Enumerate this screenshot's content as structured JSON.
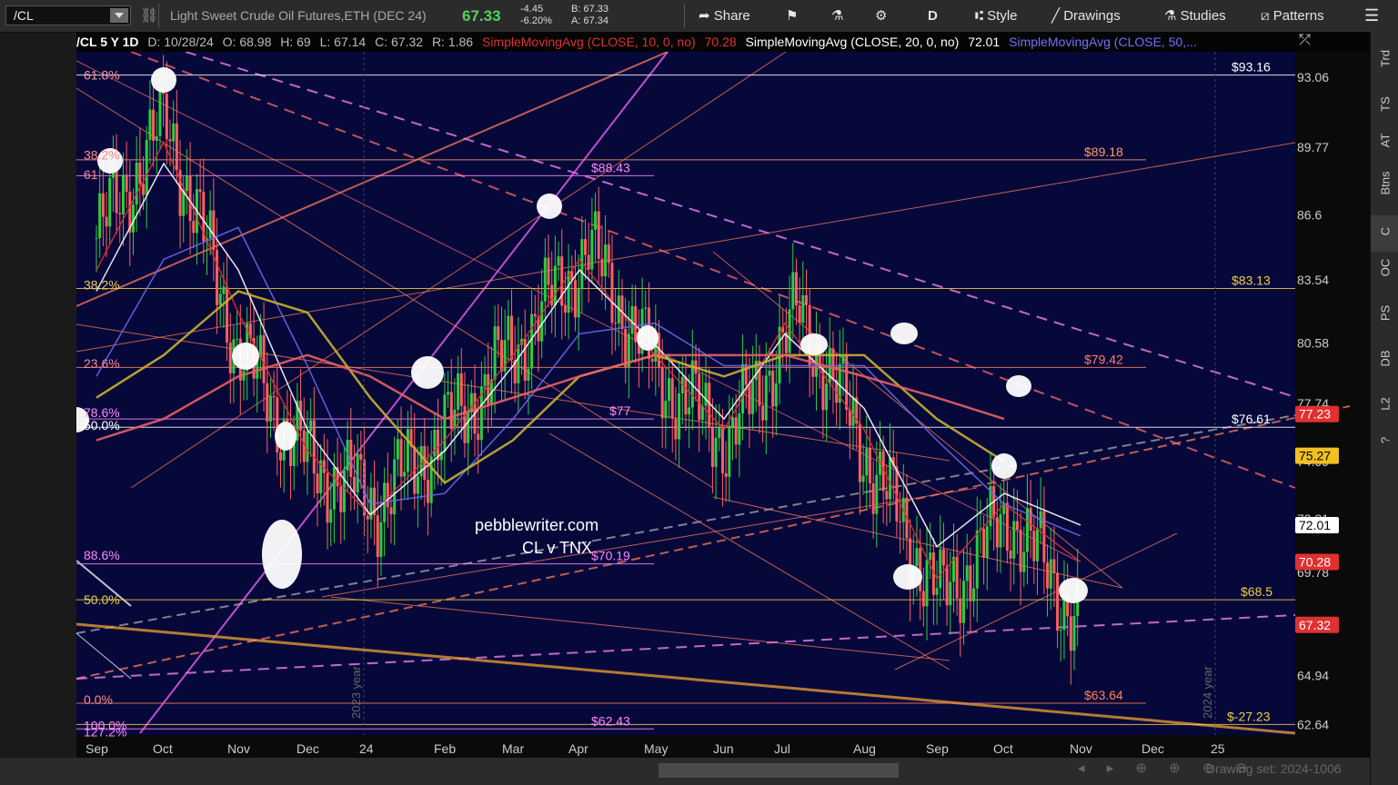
{
  "toolbar": {
    "symbol": "/CL",
    "description": "Light Sweet Crude Oil Futures,ETH (DEC 24)",
    "last": "67.33",
    "net_change": "-4.45",
    "pct_change": "-6.20%",
    "bid": "B: 67.33",
    "ask": "A: 67.34",
    "share": "Share",
    "period": "D",
    "style": "Style",
    "drawings": "Drawings",
    "studies": "Studies",
    "patterns": "Patterns"
  },
  "study_bar": {
    "chart_id": "/CL 5 Y 1D",
    "date": "D: 10/28/24",
    "open": "O: 68.98",
    "high": "H: 69",
    "low": "L: 67.14",
    "close": "C: 67.32",
    "range": "R: 1.86",
    "sma10": "SimpleMovingAvg (CLOSE, 10, 0, no)",
    "sma10_val": "70.28",
    "sma20": "SimpleMovingAvg (CLOSE, 20, 0, no)",
    "sma20_val": "72.01",
    "sma50": "SimpleMovingAvg (CLOSE, 50,..."
  },
  "right_panel": [
    "Trd",
    "TS",
    "AT",
    "Btns",
    "C",
    "OC",
    "PS",
    "DB",
    "L2",
    "?"
  ],
  "bottom": {
    "drawing_set": "Drawing set: 2024-1006"
  },
  "colors": {
    "bg": "#06083a",
    "sma10": "#e03030",
    "sma20": "#ffffff",
    "sma50": "#6a6af0",
    "sma100": "#c8b030",
    "sma200": "#e86060",
    "up": "#2ecc40",
    "down": "#ff6060"
  },
  "chart_data": {
    "type": "line",
    "title": "",
    "xlabel": "",
    "ylabel": "",
    "ylim": [
      62.0,
      94.0
    ],
    "x_axis_labels": [
      "Sep",
      "Oct",
      "Nov",
      "Dec",
      "24",
      "Feb",
      "Mar",
      "Apr",
      "May",
      "Jun",
      "Jul",
      "Aug",
      "Sep",
      "Oct",
      "Nov",
      "Dec",
      "25"
    ],
    "y_axis_ticks": [
      93.06,
      89.77,
      86.6,
      83.54,
      80.58,
      77.74,
      74.99,
      72.31,
      69.78,
      64.94,
      62.64
    ],
    "x": [
      "2023-09",
      "2023-10",
      "2023-11",
      "2023-12",
      "2024-01",
      "2024-02",
      "2024-03",
      "2024-04",
      "2024-05",
      "2024-06",
      "2024-07",
      "2024-08",
      "2024-09",
      "2024-10",
      "2024-11",
      "2024-12",
      "2025-01"
    ],
    "series": [
      {
        "name": "",
        "values": [
          85.5,
          91.0,
          80.5,
          75.0,
          73.0,
          76.5,
          80.5,
          85.0,
          79.0,
          76.0,
          82.0,
          75.0,
          68.5,
          72.5,
          67.32,
          null,
          null
        ]
      },
      {
        "name": "SimpleMovingAvg (CLOSE, 10, 0, no)",
        "values": [
          84.0,
          90.0,
          82.0,
          75.5,
          72.5,
          76.0,
          80.0,
          84.5,
          80.0,
          76.5,
          81.5,
          76.5,
          69.5,
          73.0,
          70.28,
          null,
          null
        ]
      },
      {
        "name": "SimpleMovingAvg (CLOSE, 20, 0, no)",
        "values": [
          83.0,
          89.0,
          84.0,
          76.5,
          72.5,
          75.5,
          79.5,
          84.0,
          80.5,
          77.0,
          81.0,
          77.5,
          71.0,
          73.5,
          72.01,
          null,
          null
        ]
      },
      {
        "name": "SimpleMovingAvg (CLOSE, 50,...",
        "values": [
          79.0,
          84.5,
          86.0,
          79.5,
          73.0,
          73.5,
          77.0,
          81.0,
          81.5,
          79.5,
          79.5,
          79.5,
          76.0,
          73.0,
          71.5,
          null,
          null
        ]
      }
    ],
    "price_labels": [
      {
        "label": "$93.16",
        "value": 93.16
      },
      {
        "label": "$89.18",
        "value": 89.18
      },
      {
        "label": "$88.43",
        "value": 88.43
      },
      {
        "label": "$83.13",
        "value": 83.13
      },
      {
        "label": "$79.42",
        "value": 79.42
      },
      {
        "label": "$77",
        "value": 77.0
      },
      {
        "label": "$76.61",
        "value": 76.61
      },
      {
        "label": "$70.19",
        "value": 70.19
      },
      {
        "label": "$68.5",
        "value": 68.5
      },
      {
        "label": "$63.64",
        "value": 63.64
      },
      {
        "label": "$62.43",
        "value": 62.43
      },
      {
        "label": "$-27.23",
        "value": 62.64
      }
    ],
    "fib_labels": [
      "61.8%",
      "38.2%",
      "61",
      "38.2%",
      "23.6%",
      "78.6%",
      "50.0%",
      "88.6%",
      "50.0%",
      "0.0%",
      "100.0%",
      "127.2%"
    ],
    "axis_badges": [
      {
        "label": "77.23",
        "value": 77.23,
        "color": "#e03030"
      },
      {
        "label": "75.27",
        "value": 75.27,
        "color": "#f0c020"
      },
      {
        "label": "72.01",
        "value": 72.01,
        "color": "#ffffff"
      },
      {
        "label": "70.28",
        "value": 70.28,
        "color": "#e03030"
      },
      {
        "label": "67.32",
        "value": 67.32,
        "color": "#e03030"
      }
    ],
    "annotations": [
      "pebblewriter.com",
      "CL v TNX",
      "2023 year",
      "2024 year"
    ],
    "grid": false,
    "legend": "top"
  }
}
